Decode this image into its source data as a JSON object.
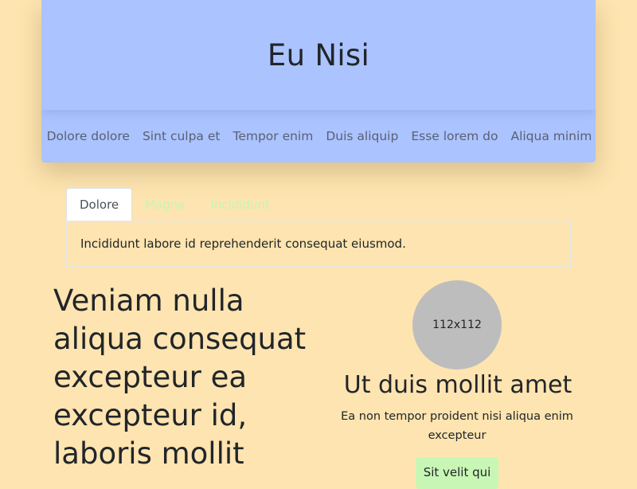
{
  "header": {
    "title": "Eu Nisi"
  },
  "nav": {
    "links": [
      "Dolore dolore",
      "Sint culpa et",
      "Tempor enim",
      "Duis aliquip",
      "Esse lorem do",
      "Aliqua minim"
    ]
  },
  "tabs": {
    "items": [
      "Dolore",
      "Magna",
      "Incididunt"
    ],
    "active_index": 0,
    "panel_text": "Incididunt labore id reprehenderit consequat eiusmod."
  },
  "hero": {
    "headline": "Veniam nulla aliqua consequat excepteur ea excepteur id, laboris mollit"
  },
  "card": {
    "avatar_label": "112x112",
    "title": "Ut duis mollit amet",
    "text": "Ea non tempor proident nisi aliqua enim excepteur",
    "button_label": "Sit velit qui"
  },
  "colors": {
    "page_background": "#fde4b0",
    "header_background": "#abc3ff",
    "inactive_tab_text": "#c8f5b3",
    "button_background": "#c8f7b5",
    "avatar_background": "#bdbdbd"
  }
}
